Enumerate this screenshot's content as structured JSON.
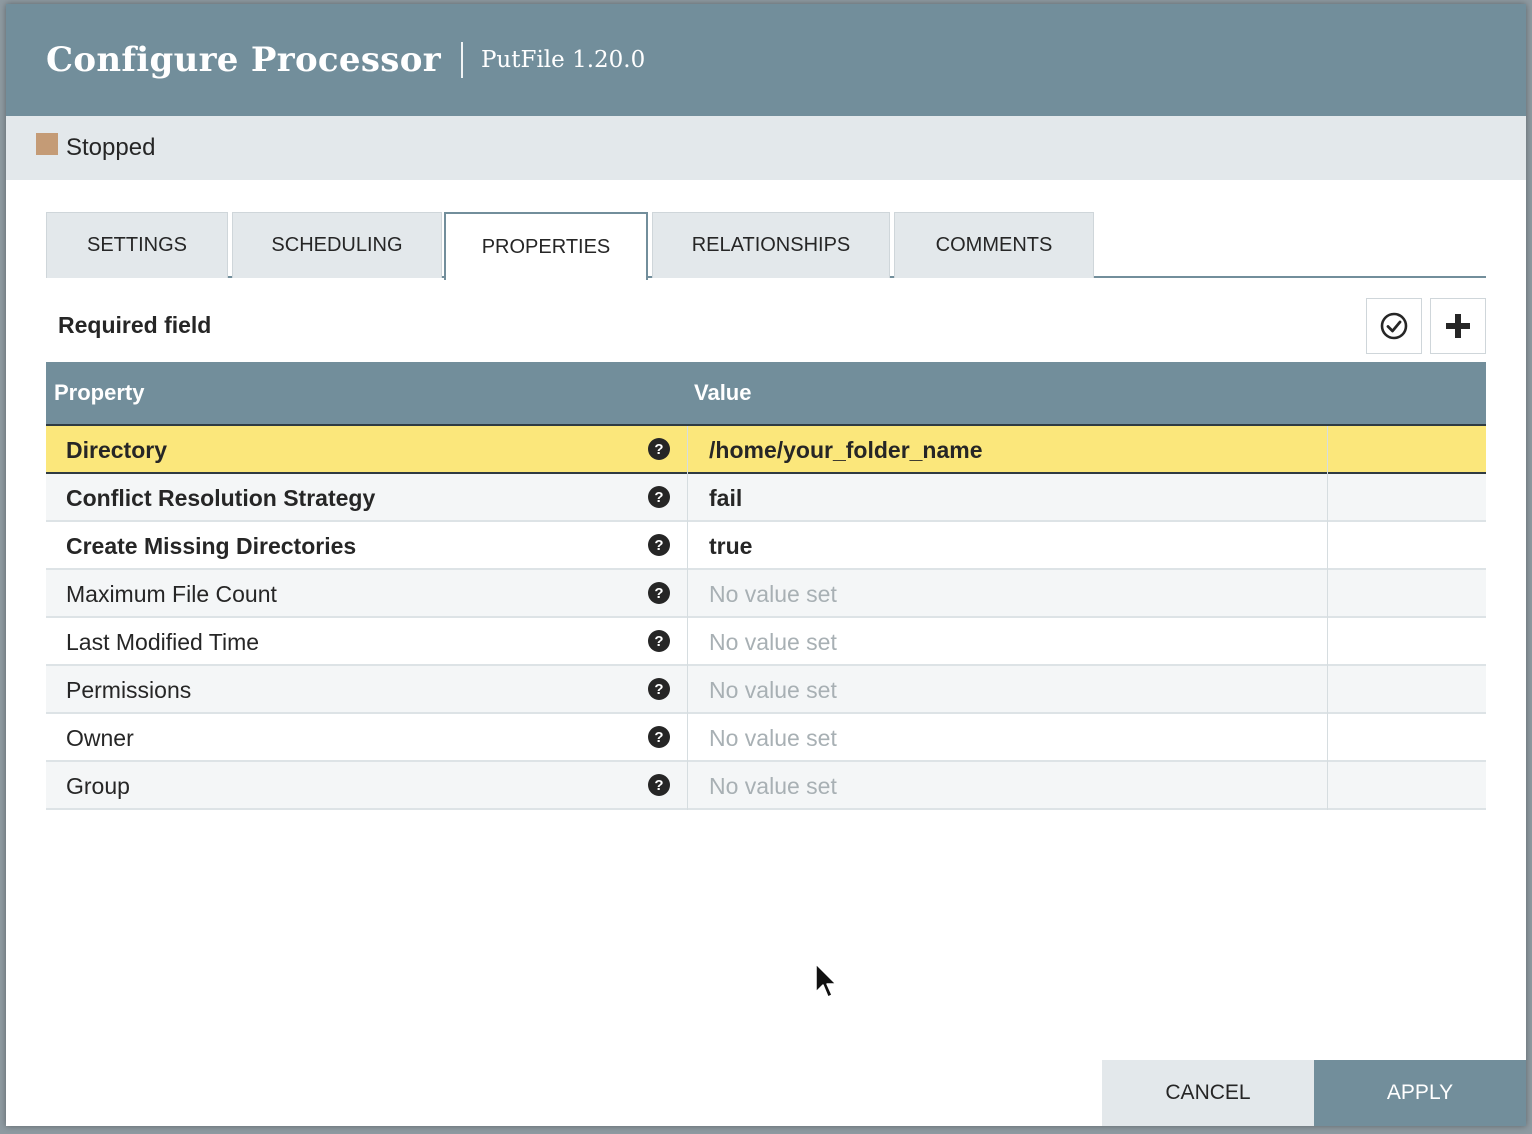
{
  "dialog": {
    "title": "Configure Processor",
    "subtitle": "PutFile 1.20.0",
    "status": "Stopped"
  },
  "tabs": [
    {
      "label": "SETTINGS",
      "active": false
    },
    {
      "label": "SCHEDULING",
      "active": false
    },
    {
      "label": "PROPERTIES",
      "active": true
    },
    {
      "label": "RELATIONSHIPS",
      "active": false
    },
    {
      "label": "COMMENTS",
      "active": false
    }
  ],
  "properties_panel": {
    "required_label": "Required field",
    "verify_icon": "check-circle-icon",
    "add_icon": "plus-icon",
    "columns": {
      "property": "Property",
      "value": "Value"
    },
    "rows": [
      {
        "name": "Directory",
        "value": "/home/your_folder_name",
        "required": true,
        "selected": true
      },
      {
        "name": "Conflict Resolution Strategy",
        "value": "fail",
        "required": true,
        "selected": false
      },
      {
        "name": "Create Missing Directories",
        "value": "true",
        "required": true,
        "selected": false
      },
      {
        "name": "Maximum File Count",
        "value": "No value set",
        "required": false,
        "selected": false
      },
      {
        "name": "Last Modified Time",
        "value": "No value set",
        "required": false,
        "selected": false
      },
      {
        "name": "Permissions",
        "value": "No value set",
        "required": false,
        "selected": false
      },
      {
        "name": "Owner",
        "value": "No value set",
        "required": false,
        "selected": false
      },
      {
        "name": "Group",
        "value": "No value set",
        "required": false,
        "selected": false
      }
    ]
  },
  "footer": {
    "cancel_label": "CANCEL",
    "apply_label": "APPLY"
  },
  "colors": {
    "header": "#728e9b",
    "status_stopped": "#c49b76",
    "selected_row": "#fbe77b",
    "light_panel": "#e3e8eb"
  }
}
